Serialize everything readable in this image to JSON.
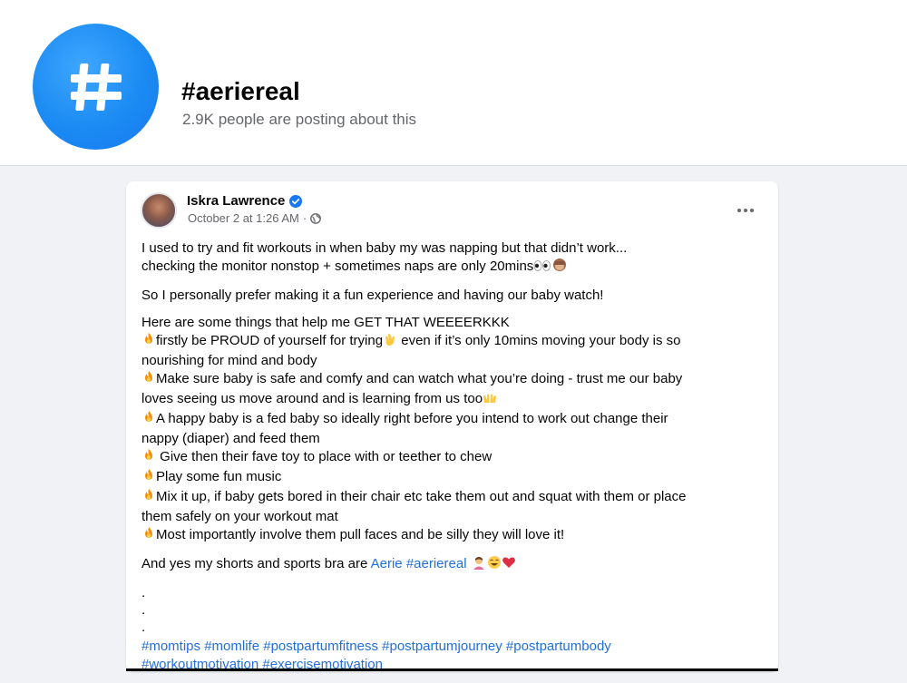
{
  "hashtag": {
    "icon": "hashtag-icon",
    "title": "#aeriereal",
    "subtitle": "2.9K people are posting about this"
  },
  "post": {
    "author": "Iskra Lawrence",
    "verified_icon": "verified-badge-icon",
    "timestamp": "October 2 at 1:26 AM",
    "separator": "·",
    "privacy_icon": "globe-icon",
    "more_icon": "more-options-icon",
    "p1": {
      "l1": "I used to try and fit workouts in when baby my was napping but that didn’t work...",
      "l2": "checking the monitor nonstop + sometimes naps are only 20mins"
    },
    "p2": "So I personally prefer making it a fun experience and having our baby watch!",
    "p3": {
      "intro": "Here are some things that help me GET THAT WEEEERKKK",
      "tip1a": "firstly be PROUD of yourself for trying",
      "tip1b": " even if it’s only 10mins moving your body is so",
      "tip1c": "nourishing for mind and body",
      "tip2a": "Make sure baby is safe and comfy and can watch what you’re doing - trust me our baby",
      "tip2b": "loves seeing us move around and is learning from us too",
      "tip3a": "A happy baby is a fed baby so ideally right before you intend to work out change their",
      "tip3b": "nappy (diaper) and feed them",
      "tip4": " Give then their fave toy to place with or teether to chew",
      "tip5": "Play some fun music",
      "tip6a": "Mix it up, if baby gets bored in their chair etc take them out and squat with them or place",
      "tip6b": "them safely on your workout mat",
      "tip7": "Most importantly involve them pull faces and be silly they will love it!"
    },
    "p4": {
      "text": "And yes my shorts and sports bra are ",
      "link1": "Aerie",
      "link2": "#aeriereal"
    },
    "dots": [
      ".",
      ".",
      "."
    ],
    "hashtags": {
      "line1": [
        "#momtips",
        "#momlife",
        "#postpartumfitness",
        "#postpartumjourney",
        "#postpartumbody"
      ],
      "line2": [
        "#workoutmotivation",
        "#exercisemotivation"
      ]
    }
  },
  "colors": {
    "link": "#216fdb",
    "verified": "#1877f2",
    "hashtag_circle": "#1b8bf2",
    "background": "#f0f2f5"
  }
}
